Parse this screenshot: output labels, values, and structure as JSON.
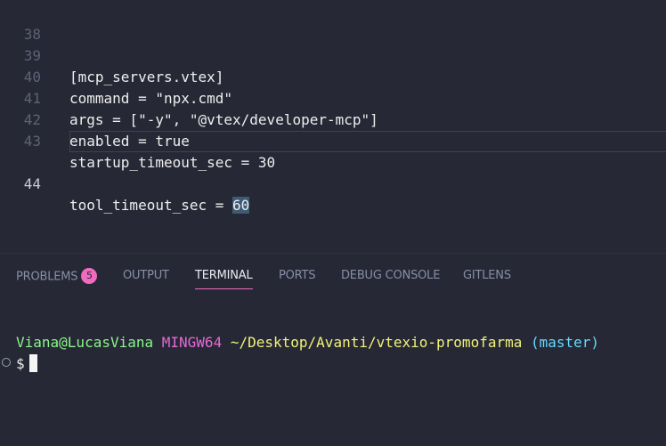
{
  "editor": {
    "lines": [
      {
        "num": "38",
        "code": ""
      },
      {
        "num": "39",
        "code": "[mcp_servers.vtex]"
      },
      {
        "num": "40",
        "code": "command = \"npx.cmd\""
      },
      {
        "num": "41",
        "code": "args = [\"-y\", \"@vtex/developer-mcp\"]"
      },
      {
        "num": "42",
        "code": "enabled = true"
      },
      {
        "num": "43",
        "code": "startup_timeout_sec = 30"
      },
      {
        "num": "44",
        "code_before": "tool_timeout_sec = ",
        "code_selected": "60"
      }
    ]
  },
  "panel": {
    "tabs": [
      {
        "label": "PROBLEMS",
        "badge": "5"
      },
      {
        "label": "OUTPUT"
      },
      {
        "label": "TERMINAL",
        "active": true
      },
      {
        "label": "PORTS"
      },
      {
        "label": "DEBUG CONSOLE"
      },
      {
        "label": "GITLENS"
      }
    ]
  },
  "terminal": {
    "user_host": "Viana@LucasViana",
    "shell": "MINGW64",
    "path": "~/Desktop/Avanti/vtexio-promofarma",
    "branch": "(master)",
    "prompt": "$"
  },
  "colors": {
    "background": "#262835",
    "accent": "#f06bbd",
    "user": "#8bf58b",
    "shell": "#e36ad4",
    "path": "#f2f27a",
    "branch": "#64d9ff"
  }
}
